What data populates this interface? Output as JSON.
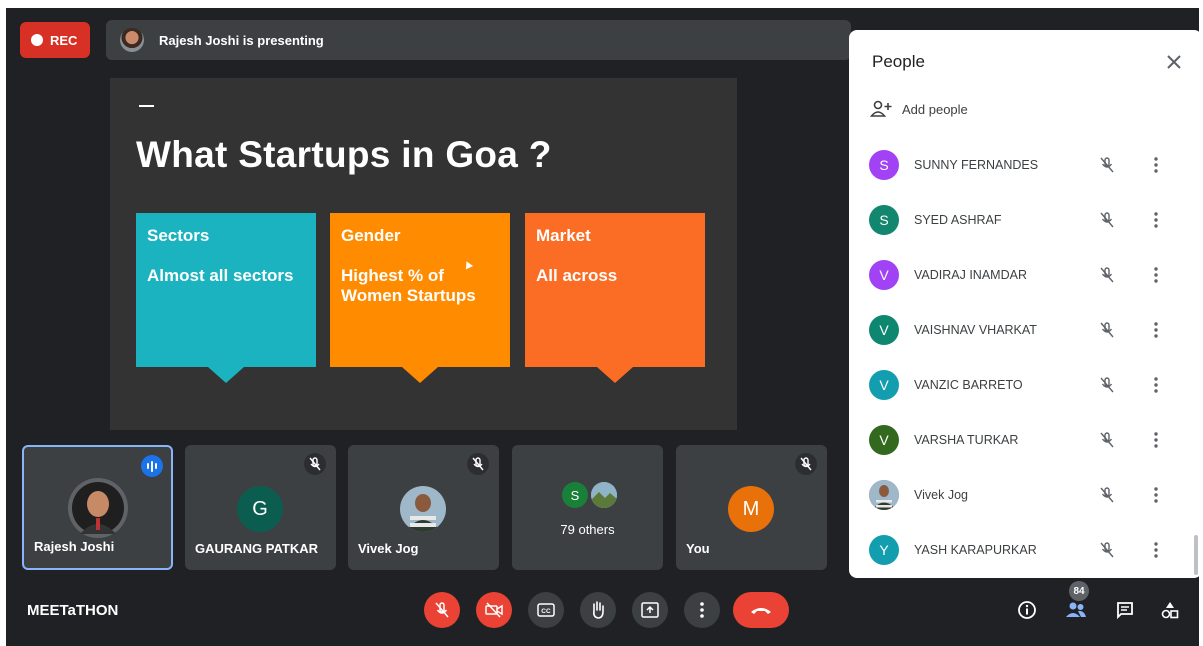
{
  "recording": {
    "label": "REC"
  },
  "presenter_banner": {
    "text": "Rajesh Joshi is presenting"
  },
  "slide": {
    "title": "What Startups in Goa ?",
    "cards": [
      {
        "heading": "Sectors",
        "body": "Almost all sectors",
        "color": "#1bb3bf"
      },
      {
        "heading": "Gender",
        "body": "Highest % of Women Startups",
        "color": "#ff8c00"
      },
      {
        "heading": "Market",
        "body": "All across",
        "color": "#fb6d24"
      }
    ]
  },
  "tiles": [
    {
      "name": "Rajesh Joshi",
      "state": "speaking"
    },
    {
      "name": "GAURANG PATKAR",
      "initial": "G",
      "avatar_color": "#0b5e4f"
    },
    {
      "name": "Vivek Jog"
    },
    {
      "label": "79 others",
      "initial": "S",
      "avatar_color": "#188038"
    },
    {
      "name": "You",
      "initial": "M",
      "avatar_color": "#e8710a"
    }
  ],
  "meeting": {
    "name": "MEETaTHON"
  },
  "controls": {
    "people_count": "84",
    "icons": [
      "mic-off-icon",
      "camera-off-icon",
      "captions-icon",
      "raise-hand-icon",
      "present-icon",
      "more-options-icon",
      "end-call-icon",
      "info-icon",
      "people-icon",
      "chat-icon",
      "activities-icon"
    ]
  },
  "people_panel": {
    "title": "People",
    "add_people": "Add people",
    "participants": [
      {
        "name": "SUNNY FERNANDES",
        "initial": "S",
        "color": "#a142f4"
      },
      {
        "name": "SYED ASHRAF",
        "initial": "S",
        "color": "#12866f"
      },
      {
        "name": "VADIRAJ INAMDAR",
        "initial": "V",
        "color": "#a142f4"
      },
      {
        "name": "VAISHNAV VHARKAT",
        "initial": "V",
        "color": "#0d8770"
      },
      {
        "name": "VANZIC BARRETO",
        "initial": "V",
        "color": "#129eaf"
      },
      {
        "name": "VARSHA TURKAR",
        "initial": "V",
        "color": "#33691e"
      },
      {
        "name": "Vivek Jog",
        "initial": "",
        "color": "#7a8a99"
      },
      {
        "name": "YASH KARAPURKAR",
        "initial": "Y",
        "color": "#129eaf"
      }
    ]
  }
}
